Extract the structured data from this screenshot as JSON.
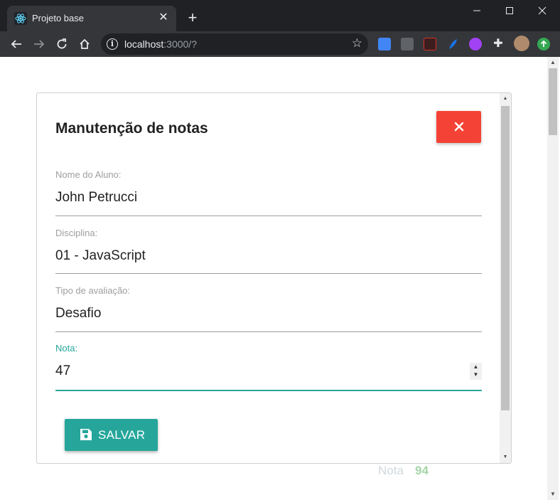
{
  "browser": {
    "tab_title": "Projeto base",
    "close_tab_glyph": "✕",
    "new_tab_glyph": "+",
    "url_host": "localhost",
    "url_rest": ":3000/?"
  },
  "modal": {
    "title": "Manutenção de notas",
    "fields": [
      {
        "label": "Nome do Aluno:",
        "value": "John Petrucci"
      },
      {
        "label": "Disciplina:",
        "value": "01 - JavaScript"
      },
      {
        "label": "Tipo de avaliação:",
        "value": "Desafio"
      },
      {
        "label": "Nota:",
        "value": "47"
      }
    ],
    "save_label": "SALVAR"
  },
  "background": {
    "nota_label": "Nota",
    "nota_value": "94"
  },
  "colors": {
    "accent": "#26a69a",
    "danger": "#f44336",
    "nota_value": "#a5d6a7"
  }
}
